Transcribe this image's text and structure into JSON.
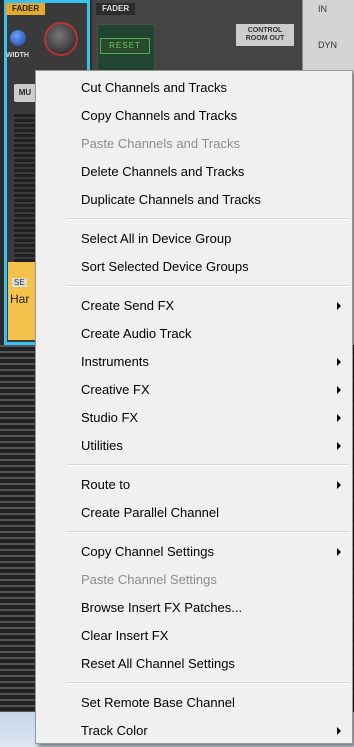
{
  "background": {
    "strip1_tab": "FADER",
    "strip2_tab": "FADER",
    "width_label": "WIDTH",
    "mute_label": "MU",
    "reset_label": "RESET",
    "control_room_label": "CONTROL ROOM OUT",
    "in_label": "IN",
    "dyn_label": "DYN",
    "se_label": "SE",
    "strip_name": "Har"
  },
  "menu": {
    "groups": [
      [
        {
          "label": "Cut Channels and Tracks",
          "enabled": true,
          "submenu": false
        },
        {
          "label": "Copy Channels and Tracks",
          "enabled": true,
          "submenu": false
        },
        {
          "label": "Paste Channels and Tracks",
          "enabled": false,
          "submenu": false
        },
        {
          "label": "Delete Channels and Tracks",
          "enabled": true,
          "submenu": false
        },
        {
          "label": "Duplicate Channels and Tracks",
          "enabled": true,
          "submenu": false
        }
      ],
      [
        {
          "label": "Select All in Device Group",
          "enabled": true,
          "submenu": false
        },
        {
          "label": "Sort Selected Device Groups",
          "enabled": true,
          "submenu": false
        }
      ],
      [
        {
          "label": "Create Send FX",
          "enabled": true,
          "submenu": true
        },
        {
          "label": "Create Audio Track",
          "enabled": true,
          "submenu": false
        },
        {
          "label": "Instruments",
          "enabled": true,
          "submenu": true
        },
        {
          "label": "Creative FX",
          "enabled": true,
          "submenu": true
        },
        {
          "label": "Studio FX",
          "enabled": true,
          "submenu": true
        },
        {
          "label": "Utilities",
          "enabled": true,
          "submenu": true
        }
      ],
      [
        {
          "label": "Route to",
          "enabled": true,
          "submenu": true
        },
        {
          "label": "Create Parallel Channel",
          "enabled": true,
          "submenu": false
        }
      ],
      [
        {
          "label": "Copy Channel Settings",
          "enabled": true,
          "submenu": true
        },
        {
          "label": "Paste Channel Settings",
          "enabled": false,
          "submenu": false
        },
        {
          "label": "Browse Insert FX Patches...",
          "enabled": true,
          "submenu": false
        },
        {
          "label": "Clear Insert FX",
          "enabled": true,
          "submenu": false
        },
        {
          "label": "Reset All Channel Settings",
          "enabled": true,
          "submenu": false
        }
      ],
      [
        {
          "label": "Set Remote Base Channel",
          "enabled": true,
          "submenu": false
        },
        {
          "label": "Track Color",
          "enabled": true,
          "submenu": true
        }
      ]
    ]
  }
}
